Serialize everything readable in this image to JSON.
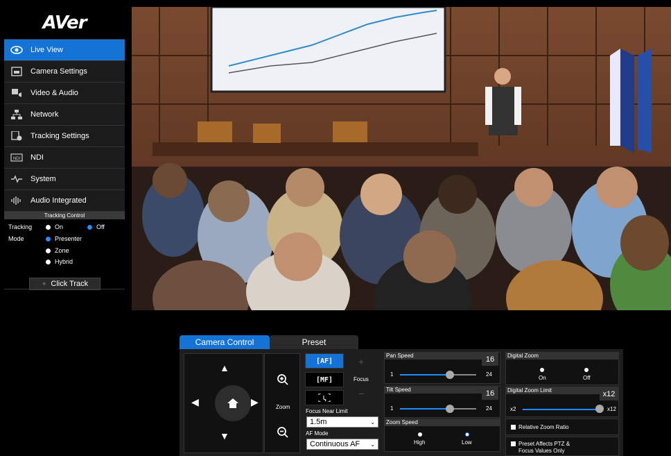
{
  "brand": {
    "logo": "AVer"
  },
  "nav": [
    {
      "label": "Live View",
      "icon": "eye-icon"
    },
    {
      "label": "Camera Settings",
      "icon": "camera-settings-icon"
    },
    {
      "label": "Video & Audio",
      "icon": "video-audio-icon"
    },
    {
      "label": "Network",
      "icon": "network-icon"
    },
    {
      "label": "Tracking Settings",
      "icon": "tracking-settings-icon"
    },
    {
      "label": "NDI",
      "icon": "ndi-icon"
    },
    {
      "label": "System",
      "icon": "system-icon"
    },
    {
      "label": "Audio Integrated",
      "icon": "audio-integrated-icon"
    }
  ],
  "tracking": {
    "title": "Tracking Control",
    "tracking_label": "Tracking",
    "mode_label": "Mode",
    "on": "On",
    "off": "Off",
    "presenter": "Presenter",
    "zone": "Zone",
    "hybrid": "Hybrid",
    "selected_power": "Off",
    "selected_mode": "Presenter",
    "click_track": "Click Track"
  },
  "tabs": {
    "camera_control": "Camera Control",
    "preset": "Preset"
  },
  "ptz": {
    "zoom_label": "Zoom",
    "focus_label": "Focus",
    "af": "AF",
    "mf": "MF"
  },
  "focus_near_limit": {
    "label": "Focus Near Limit",
    "value": "1.5m"
  },
  "af_mode": {
    "label": "AF Mode",
    "value": "Continuous AF"
  },
  "pan_speed": {
    "label": "Pan Speed",
    "value": "16",
    "min": "1",
    "max": "24"
  },
  "tilt_speed": {
    "label": "Tilt Speed",
    "value": "16",
    "min": "1",
    "max": "24"
  },
  "zoom_speed": {
    "label": "Zoom Speed",
    "high": "High",
    "low": "Low",
    "selected": "Low"
  },
  "digital_zoom": {
    "label": "Digital Zoom",
    "on": "On",
    "off": "Off"
  },
  "digital_zoom_limit": {
    "label": "Digital Zoom Limit",
    "value": "x12",
    "min": "x2",
    "max": "x12"
  },
  "options": {
    "relative_zoom": "Relative Zoom Ratio",
    "preset_affects_line1": "Preset Affects PTZ &",
    "preset_affects_line2": "Focus Values Only"
  }
}
